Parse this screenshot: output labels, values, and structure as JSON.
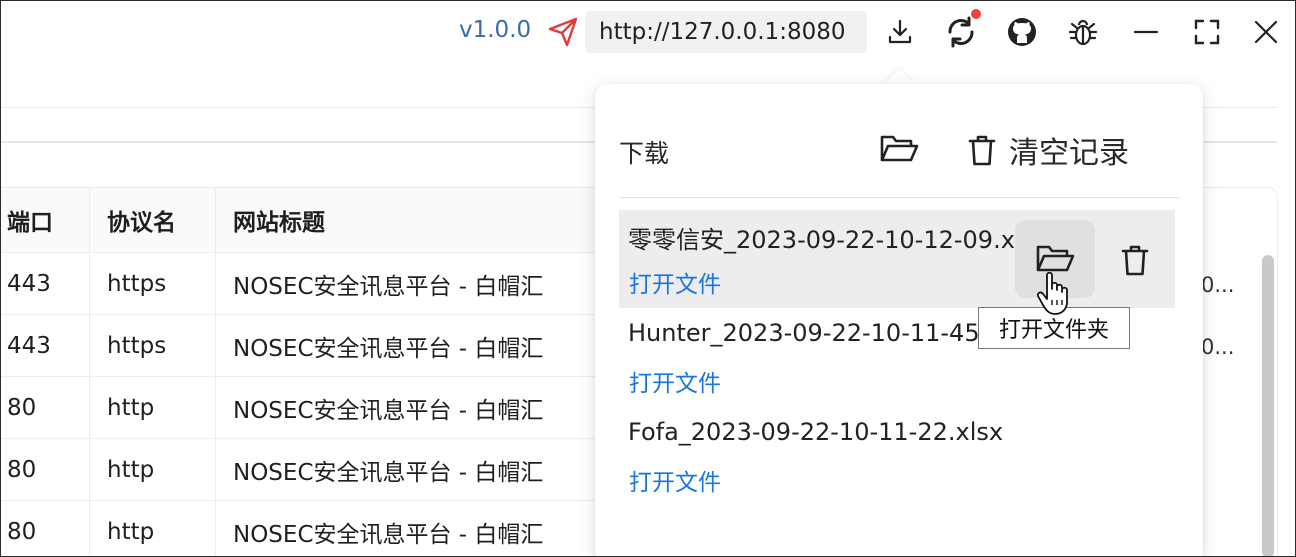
{
  "titlebar": {
    "version": "v1.0.0",
    "url": "http://127.0.0.1:8080",
    "icons": [
      "send-icon",
      "download-icon",
      "sync-icon",
      "github-icon",
      "bug-icon",
      "minimize-icon",
      "fullscreen-icon",
      "close-icon"
    ],
    "accent_color": "#3d6aa8",
    "notification_color": "#f04040"
  },
  "table": {
    "columns": [
      "端口",
      "协议名",
      "网站标题"
    ],
    "rows": [
      {
        "port": "443",
        "protocol": "https",
        "title": "NOSEC安全讯息平台 - 白帽汇",
        "extra": "0..."
      },
      {
        "port": "443",
        "protocol": "https",
        "title": "NOSEC安全讯息平台 - 白帽汇",
        "extra": "0..."
      },
      {
        "port": "80",
        "protocol": "http",
        "title": "NOSEC安全讯息平台 - 白帽汇",
        "extra": ""
      },
      {
        "port": "80",
        "protocol": "http",
        "title": "NOSEC安全讯息平台 - 白帽汇",
        "extra": ""
      },
      {
        "port": "80",
        "protocol": "http",
        "title": "NOSEC安全讯息平台 - 白帽汇",
        "extra": ""
      }
    ]
  },
  "downloads": {
    "title": "下载",
    "clear_label": "清空记录",
    "items": [
      {
        "name": "零零信安_2023-09-22-10-12-09.xlsx",
        "open_label": "打开文件"
      },
      {
        "name": "Hunter_2023-09-22-10-11-45.xlsx",
        "open_label": "打开文件"
      },
      {
        "name": "Fofa_2023-09-22-10-11-22.xlsx",
        "open_label": "打开文件"
      }
    ],
    "tooltip": "打开文件夹",
    "link_color": "#1976e0"
  }
}
